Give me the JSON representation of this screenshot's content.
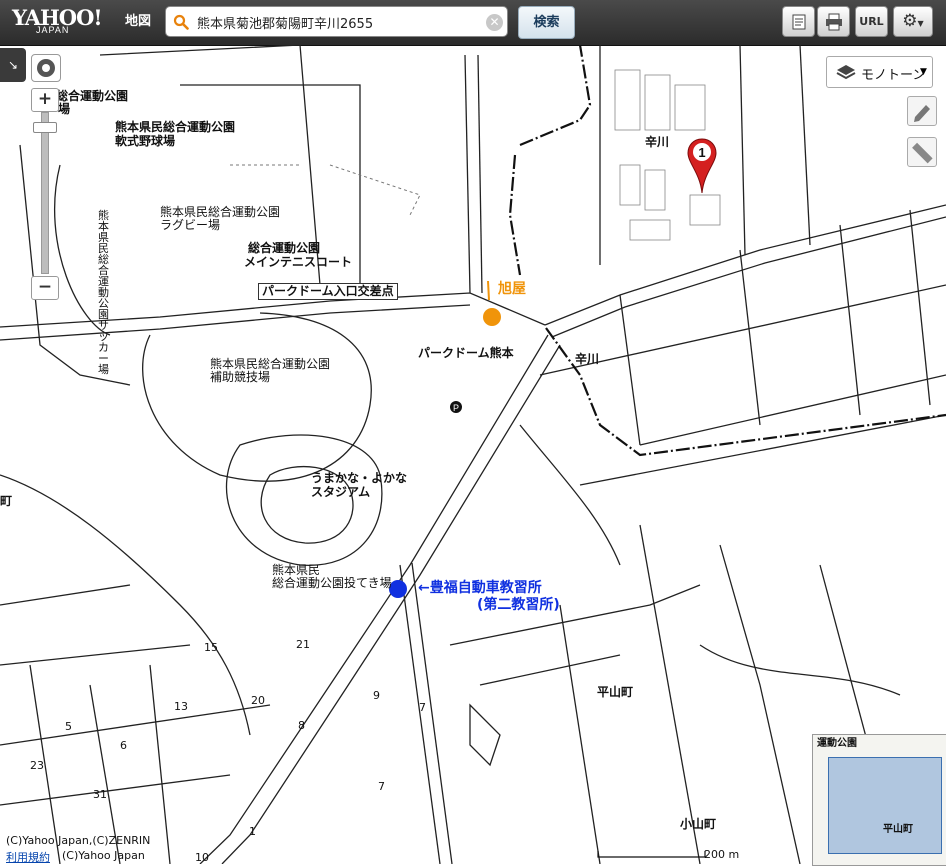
{
  "header": {
    "logo_main": "YAHOO!",
    "logo_sub": "JAPAN",
    "logo_map": "地図",
    "search_value": "熊本県菊池郡菊陽町辛川2655",
    "search_button": "検索",
    "tools": [
      {
        "icon": "print-preview-icon"
      },
      {
        "icon": "printer-icon"
      },
      {
        "label": "URL"
      },
      {
        "icon": "gear-icon"
      }
    ]
  },
  "map_controls": {
    "style_selector": "モノトーン",
    "scale_label": "200 m"
  },
  "labels": {
    "park_top": "総合運動公園",
    "park_top2": "場",
    "softball": "熊本県民総合運動公園",
    "softball2": "軟式野球場",
    "rugby": "熊本県民総合運動公園",
    "rugby2": "ラグビー場",
    "soccer": "熊本県民総合運動公園サッカー場",
    "tennis": "総合運動公園",
    "tennis2": "メインテニスコート",
    "intersection": "パークドーム入口交差点",
    "asahiya": "旭屋",
    "parkdome": "パークドーム熊本",
    "auxfield": "熊本県民総合運動公園",
    "auxfield2": "補助競技場",
    "stadium": "うまかな・よかな",
    "stadium2": "スタジアム",
    "throwing": "熊本県民",
    "throwing2": "総合運動公園投てき場",
    "school": "←豊福自動車教習所",
    "school2": "(第二教習所)",
    "karakawa_top": "辛川",
    "karakawa_mid": "辛川",
    "hirayama": "平山町",
    "koyama": "小山町",
    "left_edge": "町",
    "inset_park": "運動公園",
    "inset_town": "平山町"
  },
  "parcel_numbers": [
    "15",
    "21",
    "13",
    "20",
    "9",
    "7",
    "8",
    "5",
    "6",
    "23",
    "31",
    "7",
    "1",
    "10"
  ],
  "footer": {
    "copyright": "(C)Yahoo Japan,(C)ZENRIN",
    "terms_link": "利用規約",
    "copyright2": "(C)Yahoo Japan"
  },
  "marker": {
    "number": "1"
  },
  "colors": {
    "asahiya_marker": "#f0940a",
    "school_marker": "#1030e0",
    "pin": "#d42020"
  }
}
